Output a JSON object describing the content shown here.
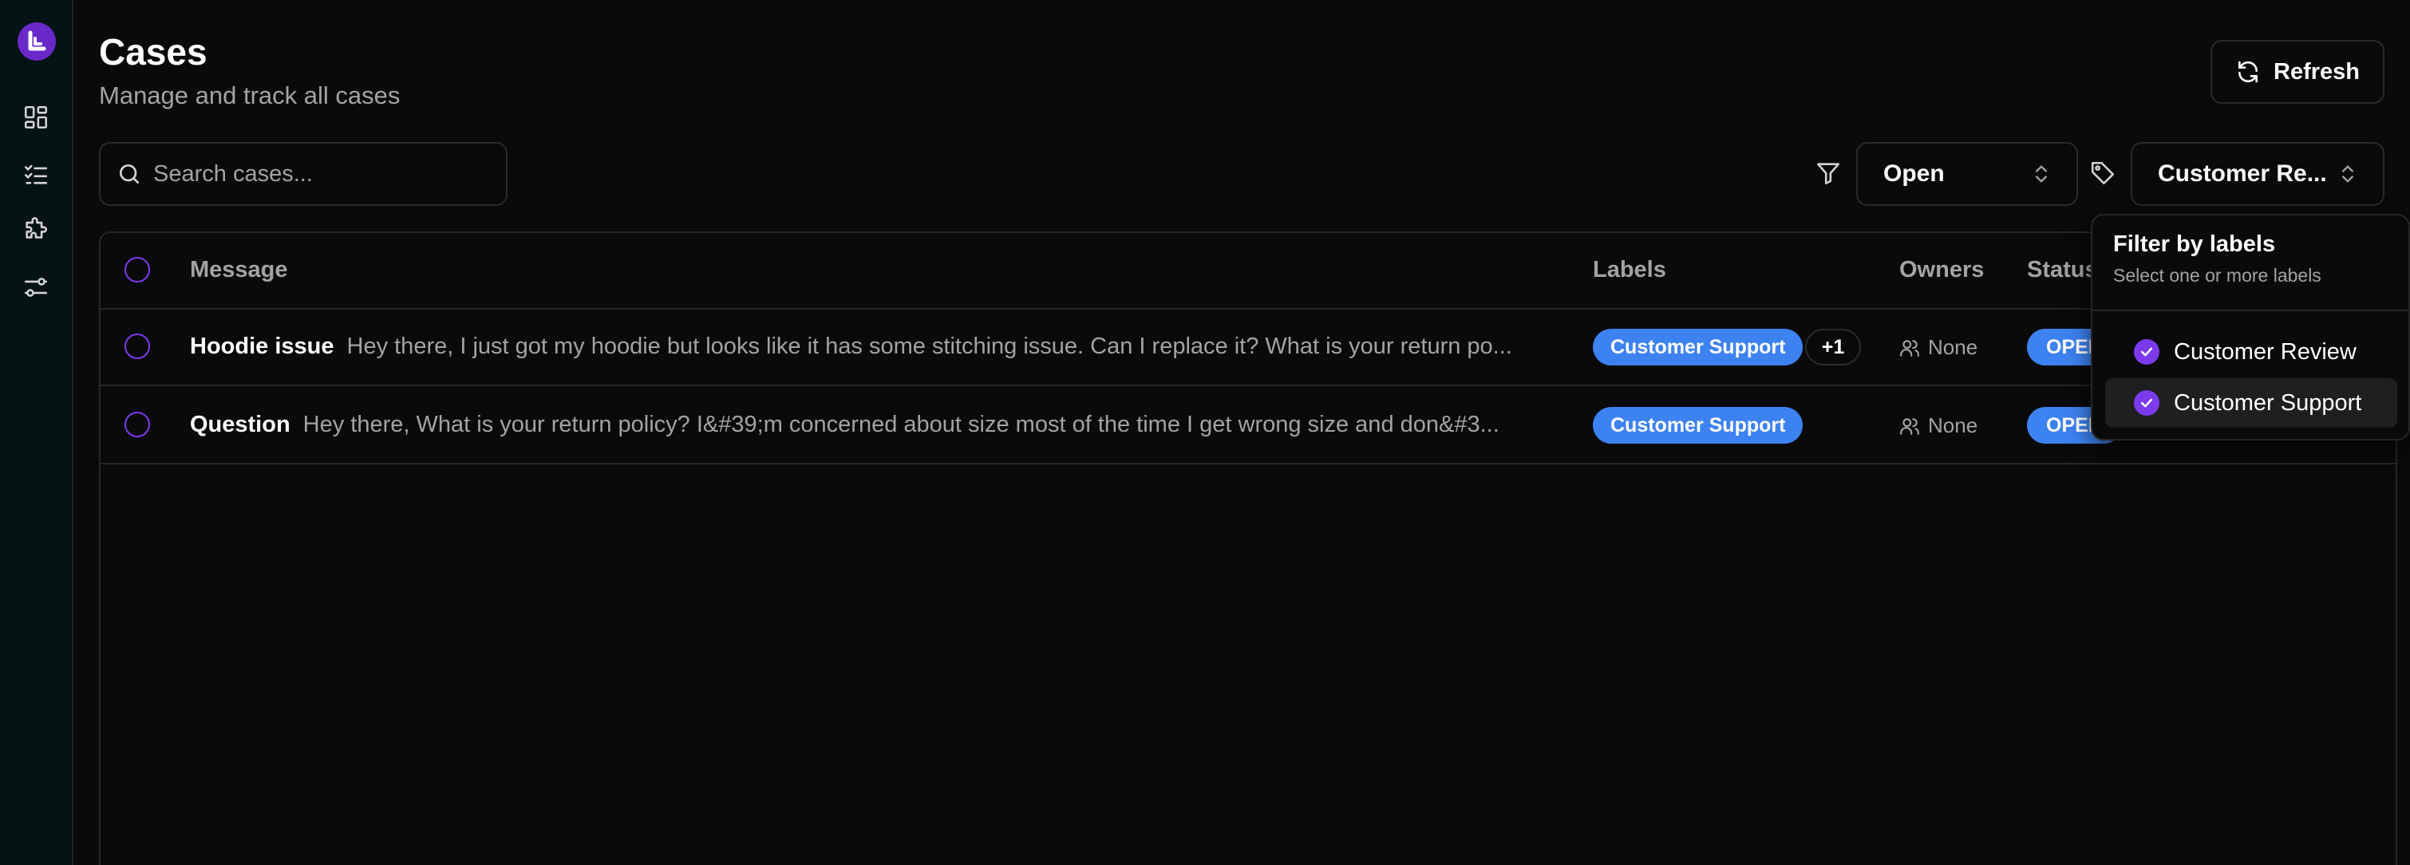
{
  "header": {
    "title": "Cases",
    "subtitle": "Manage and track all cases",
    "refresh_label": "Refresh"
  },
  "search": {
    "placeholder": "Search cases...",
    "value": ""
  },
  "filters": {
    "status_value": "Open",
    "labels_value": "Customer Re..."
  },
  "table": {
    "columns": {
      "message": "Message",
      "labels": "Labels",
      "owners": "Owners",
      "status": "Status"
    },
    "rows": [
      {
        "title": "Hoodie issue",
        "body": "Hey there, I just got my hoodie but looks like it has some stitching issue. Can I replace it? What is your return po...",
        "label": "Customer Support",
        "extra_labels": "+1",
        "owner": "None",
        "status": "OPEN"
      },
      {
        "title": "Question",
        "body": "Hey there, What is your return policy? I&#39;m concerned about size most of the time I get wrong size and don&#3...",
        "label": "Customer Support",
        "extra_labels": "",
        "owner": "None",
        "status": "OPEN"
      }
    ]
  },
  "label_popover": {
    "title": "Filter by labels",
    "subtitle": "Select one or more labels",
    "options": [
      {
        "label": "Customer Review",
        "checked": true
      },
      {
        "label": "Customer Support",
        "checked": true
      }
    ]
  },
  "colors": {
    "accent": "#7c3aed",
    "badge": "#3d82f1",
    "background": "#0a0a0a",
    "sidebar": "#061314"
  },
  "icons": {
    "sidebar": [
      "dashboard-icon",
      "checklist-icon",
      "puzzle-icon",
      "settings-sliders-icon"
    ]
  }
}
